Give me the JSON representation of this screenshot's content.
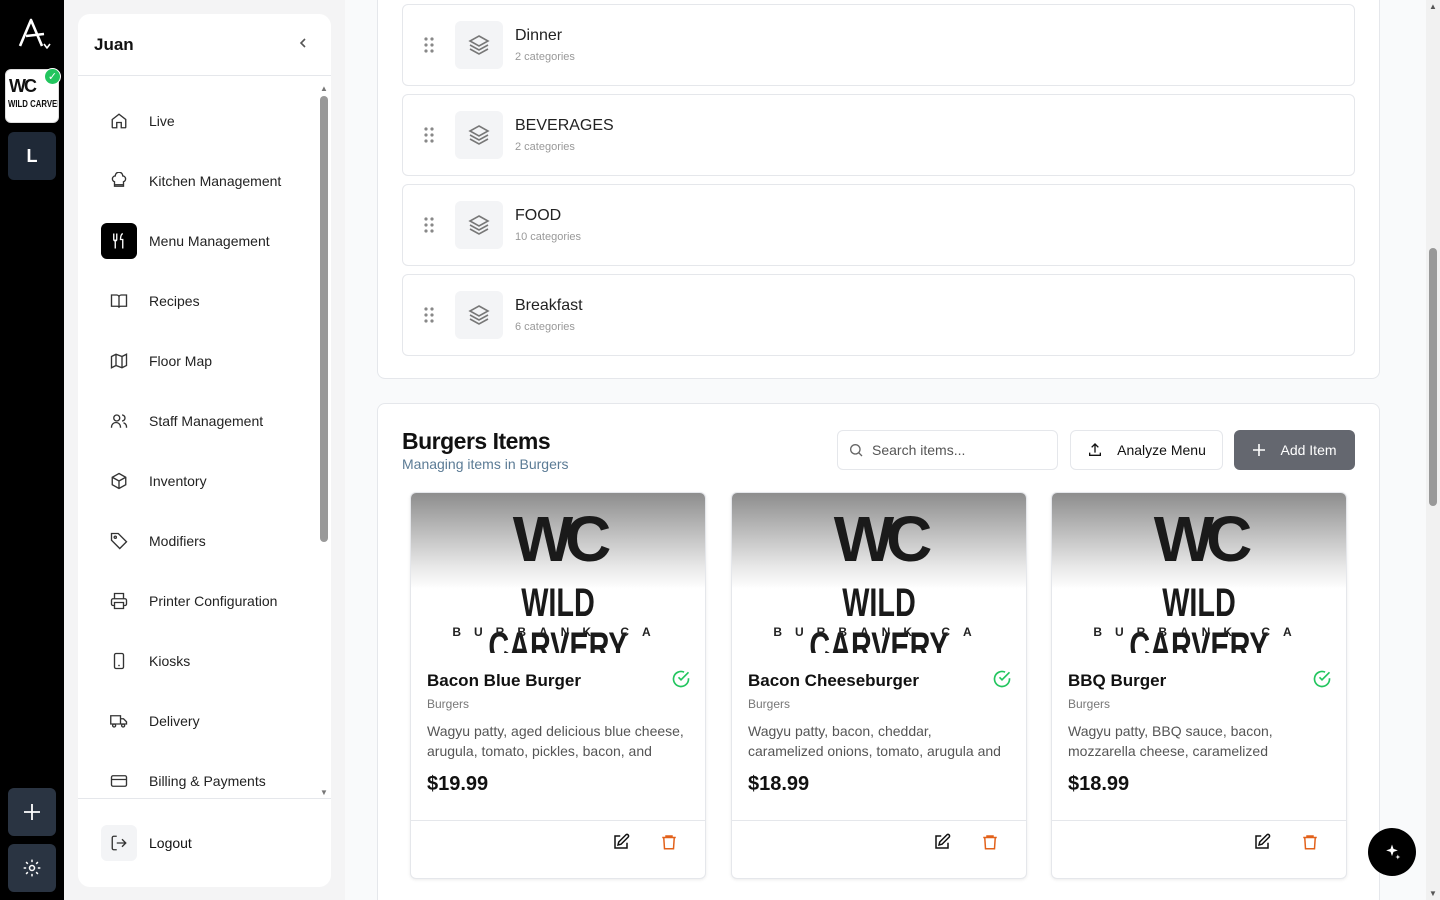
{
  "rail": {
    "logo_icon": "brand-a-icon",
    "org_tile": {
      "mark": "WC",
      "name": "WILD CARVER"
    },
    "workspace_letter": "L",
    "add_icon": "plus-icon",
    "settings_icon": "gear-icon"
  },
  "sidebar": {
    "user": "Juan",
    "items": [
      {
        "label": "Live",
        "icon": "home-icon"
      },
      {
        "label": "Kitchen Management",
        "icon": "chef-hat-icon"
      },
      {
        "label": "Menu Management",
        "icon": "utensils-icon",
        "active": true
      },
      {
        "label": "Recipes",
        "icon": "book-icon"
      },
      {
        "label": "Floor Map",
        "icon": "map-icon"
      },
      {
        "label": "Staff Management",
        "icon": "users-icon"
      },
      {
        "label": "Inventory",
        "icon": "package-icon"
      },
      {
        "label": "Modifiers",
        "icon": "tag-icon"
      },
      {
        "label": "Printer Configuration",
        "icon": "printer-icon"
      },
      {
        "label": "Kiosks",
        "icon": "tablet-icon"
      },
      {
        "label": "Delivery",
        "icon": "truck-icon"
      },
      {
        "label": "Billing & Payments",
        "icon": "credit-card-icon"
      }
    ],
    "logout": "Logout"
  },
  "menus": [
    {
      "name": "Dinner",
      "count": "2 categories"
    },
    {
      "name": "BEVERAGES",
      "count": "2 categories"
    },
    {
      "name": "FOOD",
      "count": "10 categories"
    },
    {
      "name": "Breakfast",
      "count": "6 categories"
    }
  ],
  "items_section": {
    "title": "Burgers Items",
    "subtitle": "Managing items in Burgers",
    "search_placeholder": "Search items...",
    "analyze_label": "Analyze Menu",
    "add_label": "Add Item"
  },
  "item_image": {
    "mark": "WC",
    "name": "WILD CARVERY",
    "location": "BURBANK CA"
  },
  "items": [
    {
      "name": "Bacon Blue Burger",
      "category": "Burgers",
      "description": "Wagyu patty, aged delicious blue cheese, arugula, tomato, pickles, bacon, and gar…",
      "price": "$19.99"
    },
    {
      "name": "Bacon Cheeseburger",
      "category": "Burgers",
      "description": "Wagyu patty, bacon, cheddar, caramelized onions, tomato, arugula and garlic aioli",
      "price": "$18.99"
    },
    {
      "name": "BBQ Burger",
      "category": "Burgers",
      "description": "Wagyu patty, BBQ sauce, bacon, mozzarella cheese, caramelized onions,…",
      "price": "$18.99"
    }
  ],
  "colors": {
    "primary": "#000000",
    "available": "#22c55e",
    "delete": "#e2611a",
    "add_button": "#64676f"
  }
}
